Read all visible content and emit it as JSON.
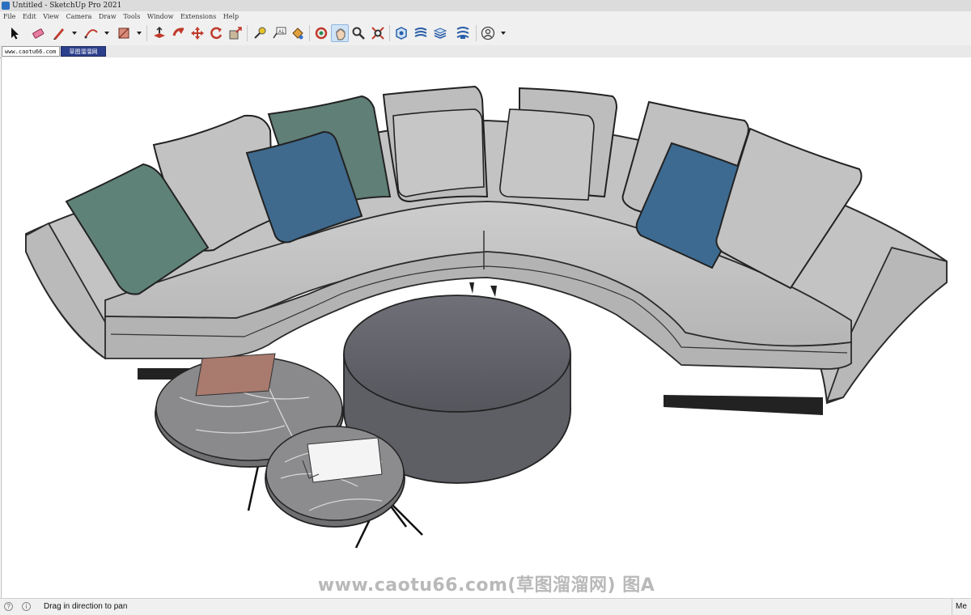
{
  "window": {
    "title": "Untitled - SketchUp Pro 2021"
  },
  "menu": [
    "File",
    "Edit",
    "View",
    "Camera",
    "Draw",
    "Tools",
    "Window",
    "Extensions",
    "Help"
  ],
  "toolbar": {
    "tools": [
      "select-tool",
      "eraser-tool",
      "line-tool",
      "arc-tool",
      "rectangle-tool",
      "push-pull-tool",
      "follow-me-tool",
      "move-tool",
      "rotate-tool",
      "scale-tool",
      "tape-measure-tool",
      "text-tool",
      "paint-bucket-tool",
      "orbit-tool",
      "pan-tool",
      "zoom-tool",
      "zoom-extents-tool",
      "3d-warehouse",
      "extension-warehouse",
      "layout-send",
      "extension-manager",
      "account"
    ],
    "active_tool": "pan-tool"
  },
  "tabs": [
    {
      "label": "www.caotu66.com",
      "active": false
    },
    {
      "label": "草图溜溜网",
      "active": true
    }
  ],
  "viewport": {
    "watermark": "www.caotu66.com(草图溜溜网) 图A",
    "colors": {
      "sofa": "#c4c4c4",
      "ottoman": "#6a6a70",
      "table_top": "#8a8a8c",
      "pillow_green": "#5f8278",
      "pillow_blue": "#3f6a8e"
    }
  },
  "status": {
    "message": "Drag in direction to pan",
    "right_label": "Me"
  }
}
